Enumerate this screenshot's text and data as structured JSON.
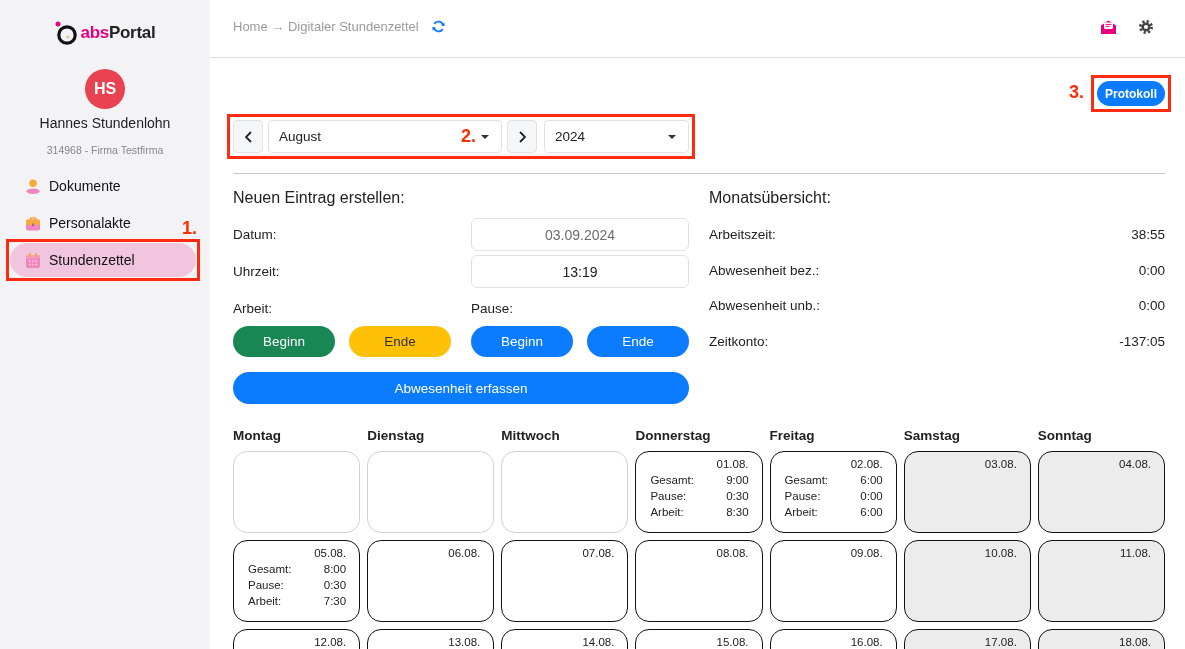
{
  "sidebar": {
    "logo": {
      "prefix": "abs",
      "name": "Portal"
    },
    "user": {
      "initials": "HS",
      "name": "Hannes Stundenlohn",
      "meta": "314968 - Firma Testfirma"
    },
    "items": [
      {
        "label": "Dokumente",
        "selected": false
      },
      {
        "label": "Personalakte",
        "selected": false
      },
      {
        "label": "Stundenzettel",
        "selected": true,
        "annotation": "1."
      }
    ]
  },
  "header": {
    "breadcrumb": "Home → Digitaler Stundenzettel"
  },
  "toolbar": {
    "button": {
      "label": "Protokoll",
      "annotation": "3."
    }
  },
  "period": {
    "month": "August",
    "year": "2024",
    "annotation": "2."
  },
  "entry": {
    "title": "Neuen Eintrag erstellen:",
    "fields": [
      {
        "label": "Datum:",
        "value": "03.09.2024",
        "disabled": true
      },
      {
        "label": "Uhrzeit:",
        "value": "13:19",
        "disabled": false
      }
    ],
    "groups": [
      {
        "label": "Arbeit:",
        "buttons": [
          {
            "label": "Beginn",
            "kind": "success"
          },
          {
            "label": "Ende",
            "kind": "warning"
          }
        ]
      },
      {
        "label": "Pause:",
        "buttons": [
          {
            "label": "Beginn",
            "kind": "primary"
          },
          {
            "label": "Ende",
            "kind": "primary"
          }
        ]
      }
    ],
    "absence_button": {
      "label": "Abwesenheit erfassen",
      "kind": "primary"
    }
  },
  "summary": {
    "title": "Monatsübersicht:",
    "rows": [
      {
        "label": "Arbeitszeit:",
        "value": "38:55"
      },
      {
        "label": "Abwesenheit bez.:",
        "value": "0:00"
      },
      {
        "label": "Abwesenheit unb.:",
        "value": "0:00"
      },
      {
        "label": "Zeitkonto:",
        "value": "-137:05"
      }
    ]
  },
  "calendar": {
    "weekdays": [
      "Montag",
      "Dienstag",
      "Mittwoch",
      "Donnerstag",
      "Freitag",
      "Samstag",
      "Sonntag"
    ],
    "weeks": [
      [
        {
          "kind": "empty"
        },
        {
          "kind": "empty"
        },
        {
          "kind": "empty"
        },
        {
          "kind": "weekday",
          "date": "01.08.",
          "stats": [
            {
              "label": "Gesamt:",
              "value": "9:00"
            },
            {
              "label": "Pause:",
              "value": "0:30"
            },
            {
              "label": "Arbeit:",
              "value": "8:30"
            }
          ]
        },
        {
          "kind": "weekday",
          "date": "02.08.",
          "stats": [
            {
              "label": "Gesamt:",
              "value": "6:00"
            },
            {
              "label": "Pause:",
              "value": "0:00"
            },
            {
              "label": "Arbeit:",
              "value": "6:00"
            }
          ]
        },
        {
          "kind": "weekend",
          "date": "03.08."
        },
        {
          "kind": "weekend",
          "date": "04.08."
        }
      ],
      [
        {
          "kind": "weekday",
          "date": "05.08.",
          "stats": [
            {
              "label": "Gesamt:",
              "value": "8:00"
            },
            {
              "label": "Pause:",
              "value": "0:30"
            },
            {
              "label": "Arbeit:",
              "value": "7:30"
            }
          ]
        },
        {
          "kind": "weekday",
          "date": "06.08."
        },
        {
          "kind": "weekday",
          "date": "07.08."
        },
        {
          "kind": "weekday",
          "date": "08.08."
        },
        {
          "kind": "weekday",
          "date": "09.08."
        },
        {
          "kind": "weekend",
          "date": "10.08."
        },
        {
          "kind": "weekend",
          "date": "11.08."
        }
      ],
      [
        {
          "kind": "weekday",
          "date": "12.08."
        },
        {
          "kind": "weekday",
          "date": "13.08."
        },
        {
          "kind": "weekday",
          "date": "14.08."
        },
        {
          "kind": "weekday",
          "date": "15.08."
        },
        {
          "kind": "weekday",
          "date": "16.08."
        },
        {
          "kind": "weekend",
          "date": "17.08."
        },
        {
          "kind": "weekend",
          "date": "18.08."
        }
      ]
    ]
  }
}
